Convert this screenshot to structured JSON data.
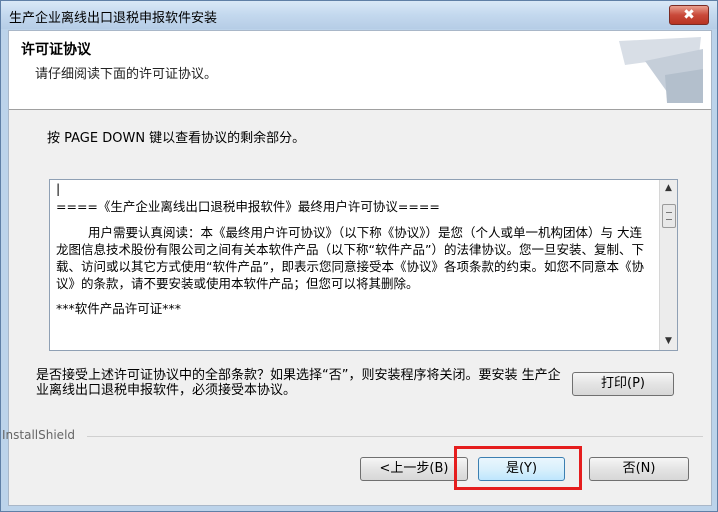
{
  "window": {
    "title": "生产企业离线出口退税申报软件安装",
    "close_label": "✖"
  },
  "header": {
    "title": "许可证协议",
    "subtitle": "请仔细阅读下面的许可证协议。"
  },
  "instruction": "按 PAGE DOWN 键以查看协议的剩余部分。",
  "license_text": {
    "cursor": "|",
    "heading": "====《生产企业离线出口退税申报软件》最终用户许可协议====",
    "paragraph": "用户需要认真阅读：本《最终用户许可协议》（以下称《协议》）是您（个人或单一机构团体）与 大连龙图信息技术股份有限公司之间有关本软件产品（以下称“软件产品”）的法律协议。您一旦安装、复制、下载、访问或以其它方式使用“软件产品”，即表示您同意接受本《协议》各项条款的约束。如您不同意本《协议》的条款，请不要安装或使用本软件产品；但您可以将其删除。",
    "section": "***软件产品许可证***"
  },
  "scrollbar": {
    "up_arrow": "▲",
    "down_arrow": "▼"
  },
  "question": "是否接受上述许可证协议中的全部条款？如果选择“否”，则安装程序将关闭。要安装 生产企业离线出口退税申报软件，必须接受本协议。",
  "buttons": {
    "print": "打印(P)",
    "back": "<上一步(B)",
    "yes": "是(Y)",
    "no": "否(N)"
  },
  "footer": {
    "brand": "InstallShield"
  },
  "colors": {
    "highlight": "#e51d1d",
    "close": "#c9493a",
    "default_button_border": "#3c7fb1"
  }
}
